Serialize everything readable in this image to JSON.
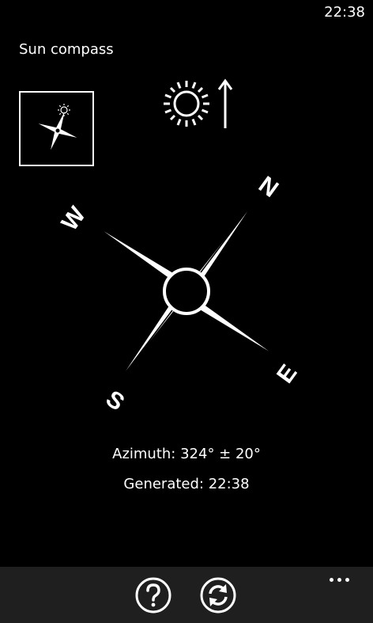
{
  "status_bar": {
    "time": "22:38"
  },
  "app": {
    "title": "Sun compass"
  },
  "compass": {
    "labels": {
      "north": "N",
      "east": "E",
      "south": "S",
      "west": "W"
    }
  },
  "info": {
    "azimuth": "Azimuth: 324° ± 20°",
    "generated": "Generated: 22:38"
  },
  "app_bar": {
    "buttons": [
      {
        "icon": "help-icon"
      },
      {
        "icon": "refresh-icon"
      }
    ],
    "more_icon": "ellipsis-icon"
  }
}
